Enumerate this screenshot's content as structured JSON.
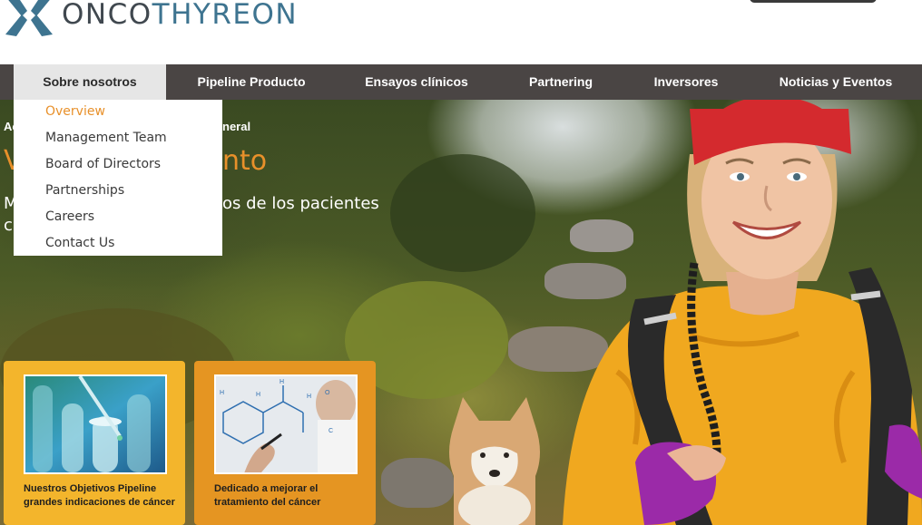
{
  "brand": {
    "name_part1": "ONCO",
    "name_part2": "THYREON",
    "colors": {
      "dark": "#40484f",
      "blue": "#3e7490",
      "accent": "#e8902a"
    },
    "logo_icon": "star-cross-logo-icon"
  },
  "nav": {
    "items": [
      {
        "label": "Sobre nosotros",
        "active": true
      },
      {
        "label": "Pipeline Producto"
      },
      {
        "label": "Ensayos clínicos"
      },
      {
        "label": "Partnering"
      },
      {
        "label": "Inversores"
      },
      {
        "label": "Noticias y Eventos"
      }
    ]
  },
  "dropdown": {
    "items": [
      {
        "label": "Overview",
        "active": true
      },
      {
        "label": "Management Team"
      },
      {
        "label": "Board of Directors"
      },
      {
        "label": "Partnerships"
      },
      {
        "label": "Careers"
      },
      {
        "label": "Contact Us"
      }
    ]
  },
  "hero": {
    "breadcrumb_start": "Ac",
    "breadcrumb_end": "neral",
    "title_start": "V",
    "title_end": "nto",
    "subtitle_line1_start": "M",
    "subtitle_line1_end": "os de los pacientes",
    "subtitle_line2_start": "c"
  },
  "cards": [
    {
      "text": "Nuestros Objetivos Pipeline grandes indicaciones de cáncer",
      "image": "test-tubes-pipette-image"
    },
    {
      "text": "Dedicado a mejorar el tratamiento del cáncer",
      "image": "scientist-molecule-image"
    }
  ]
}
